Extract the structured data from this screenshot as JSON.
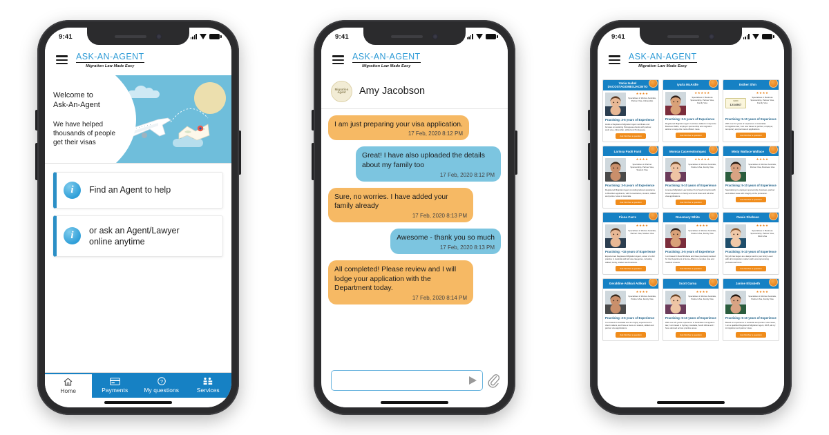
{
  "brand": {
    "name": "ASK-AN-AGENT",
    "tagline": "Migration Law Made Easy"
  },
  "status": {
    "time": "9:41",
    "signal_icon": "signal-bars-icon",
    "wifi_icon": "wifi-icon",
    "battery_icon": "battery-icon"
  },
  "phone_home": {
    "hero": {
      "title": "Welcome to\nAsk-An-Agent",
      "subtitle": "We have helped\nthousands of people\nget their visas",
      "illustration": [
        "airplane-icon",
        "cloud-icon",
        "sun-icon",
        "world-map-icon",
        "location-pin-icon"
      ]
    },
    "info_cards": [
      {
        "icon": "info-circle-icon",
        "label": "Find an Agent to help"
      },
      {
        "icon": "info-circle-icon",
        "label": "or ask an Agent/Lawyer\nonline anytime"
      }
    ],
    "tabs": [
      {
        "label": "Home",
        "icon": "home-icon",
        "active": true
      },
      {
        "label": "Payments",
        "icon": "card-icon",
        "active": false
      },
      {
        "label": "My questions",
        "icon": "question-circle-icon",
        "active": false
      },
      {
        "label": "Services",
        "icon": "services-grid-icon",
        "active": false
      }
    ]
  },
  "phone_chat": {
    "contact": {
      "name": "Amy Jacobson",
      "avatar_line1": "Migration",
      "avatar_line2": "Agent"
    },
    "messages": [
      {
        "from": "them",
        "text": "I am just preparing your visa application.",
        "time": "17 Feb, 2020 8:12 PM"
      },
      {
        "from": "me",
        "text": "Great! I have also uploaded the details about my family too",
        "time": "17 Feb, 2020 8:12 PM"
      },
      {
        "from": "them",
        "text": "Sure, no worries. I have added your family already",
        "time": "17 Feb, 2020 8:13 PM"
      },
      {
        "from": "me",
        "text": "Awesome - thank you so much",
        "time": "17 Feb, 2020 8:13 PM"
      },
      {
        "from": "them",
        "text": "All completed! Please review and I will lodge your application with the Department today.",
        "time": "17 Feb, 2020 8:14 PM"
      }
    ],
    "input": {
      "value": "",
      "placeholder": "",
      "send_icon": "send-arrow-icon",
      "attach_icon": "paperclip-icon"
    }
  },
  "phone_agents": {
    "button_label": "Ask him/her a question",
    "agents": [
      {
        "name": "Vania Isabel DACOSTAGOMESJACINTO",
        "stars": "★★★★",
        "specialty": "Specialises in Worker Australia, Partner Visa, Citizenship",
        "experience": "Practising: 3-5 years of Experience",
        "description": "Holds a Registered Migration Agent certificate and focuses on assisting Portuguese clients with partner, work visa, citizenship, skilled and Portuguese.",
        "license": ""
      },
      {
        "name": "Iyarla McArdle",
        "stars": "★★★★★",
        "specialty": "Specialises in Business Sponsorship, Partner Visa, Family Visa",
        "experience": "Practising: 3-5 years of Experience",
        "description": "Registered Migration Agent combines skilled in Corporate Business Skills, employer sponsorship and migration advice to lodge the most efficient route.",
        "license": ""
      },
      {
        "name": "Esther Shin",
        "stars": "★★★★",
        "specialty": "Specialises in Business Sponsorship, Partner Visa, Family Visa",
        "experience": "Practising: 5-10 years of Experience",
        "description": "With over 10 years of experience in Australian immigration law, I am now based in partner, employer, temporary and permanent applications.",
        "license": "1234567"
      },
      {
        "name": "Larissa Paoli Fanti",
        "stars": "★★★★",
        "specialty": "Specialises in Partner Sponsorship, Partner Visa, Student Visa",
        "experience": "Practising: 3-5 years of Experience",
        "description": "Registered Migration Agent providing tailored assistance to Brazilian applicants, with humanitarian, student, skilled and partner visas in Australia.",
        "license": ""
      },
      {
        "name": "Monica CaceresEnriquez",
        "stars": "★★★★★",
        "specialty": "Specialises in Worker Australia, Partner Visa, Family Visa",
        "experience": "Practising: 5-10 years of Experience",
        "description": "Licensed Migration Law Advisor from South America with broad experience in family and work visas and all other visa applications.",
        "license": ""
      },
      {
        "name": "Misty Wallace Wallace",
        "stars": "★★★★",
        "specialty": "Specialises in Worker Australia, Partner Visa, Business Visa",
        "experience": "Practising: 5-10 years of Experience",
        "description": "Specialising in employer sponsorship, business, partner and skilled visas with integrity of the profession.",
        "license": ""
      },
      {
        "name": "Fiona Carre",
        "stars": "★★★★",
        "specialty": "Specialises in Worker Australia, Partner Visa, Student Visa",
        "experience": "Practising: +15 years of Experience",
        "description": "Experienced Registered Migration Agent, owner of a full practice in Australia with all visa categories, including skilled, family, student and business.",
        "license": ""
      },
      {
        "name": "Rosemary White",
        "stars": "★★★★",
        "specialty": "Specialises in Worker Australia, Partner Visa, Family Visa",
        "experience": "Practising: 3-5 years of Experience",
        "description": "I am based in New Brisbane and have previously worked for the Department of Home Affairs in complex visa and resident reviews.",
        "license": ""
      },
      {
        "name": "Owais Shaheen",
        "stars": "★★★★",
        "specialty": "Specialises in Business Sponsorship, Partner Visa, Work Visa",
        "experience": "Practising: 5-10 years of Experience",
        "description": "My job has begun as a lawyer and is your Entry Level with all immigration matters with uncompromising professional focus.",
        "license": ""
      },
      {
        "name": "Geraldine Adikari Adikari",
        "stars": "★★★★",
        "specialty": "Specialises in Worker Australia, Partner Visa, Family Visa",
        "experience": "Practising: 3-5 years of Experience",
        "description": "I am based in Australia and am highly experienced in client matters, and have a focus on student, skilled and partner visa applications.",
        "license": ""
      },
      {
        "name": "Scott Garna",
        "stars": "★★★★",
        "specialty": "Specialises in Worker Australia, Partner Visa, Family Visa",
        "experience": "Practising: 5-10 years of Experience",
        "description": "With over 20 years experience in Australian immigration law, I am based in Sydney, Australia, South Africa and I have advised across practice areas.",
        "license": ""
      },
      {
        "name": "Janine Elizabeth",
        "stars": "★★★★",
        "specialty": "Specialises in Worker Australia, Partner Visa, Family Visa",
        "experience": "Practising: 5-10 years of Experience",
        "description": "Based on experience in Australia and partner visa cases, I am a qualified Registered Migration Agent, 2015, all my immigration and partner visas.",
        "license": ""
      }
    ]
  }
}
